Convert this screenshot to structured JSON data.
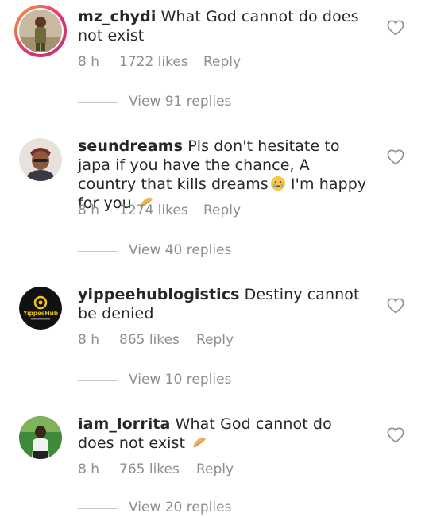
{
  "comments": [
    {
      "username": "mz_chydi",
      "text": "What God cannot do does not exist",
      "time": "8 h",
      "likes": "1722 likes",
      "reply": "Reply",
      "view_replies": "View 91 replies",
      "has_story_ring": true
    },
    {
      "username": "seundreams",
      "text": "Pls don't hesitate to japa if you have the chance, A country that kills dreams",
      "text_after_emoji": " I'm happy for you",
      "time": "8 h",
      "likes": "1274 likes",
      "reply": "Reply",
      "view_replies": "View 40 replies"
    },
    {
      "username": "yippeehublogistics",
      "text": "Destiny cannot be denied",
      "time": "8 h",
      "likes": "865 likes",
      "reply": "Reply",
      "view_replies": "View 10 replies",
      "avatar_logo_text": "YippeeHub"
    },
    {
      "username": "iam_lorrita",
      "text": "What God cannot do does not exist",
      "time": "8 h",
      "likes": "765 likes",
      "reply": "Reply",
      "view_replies": "View 20 replies"
    }
  ],
  "icons": {
    "like": "heart-outline-icon",
    "pray_emoji": "folded-hands-emoji",
    "sad_emoji": "crying-face-emoji"
  },
  "colors": {
    "text": "#262626",
    "secondary": "#8e8e8e",
    "story_ring": "#e1306c"
  }
}
